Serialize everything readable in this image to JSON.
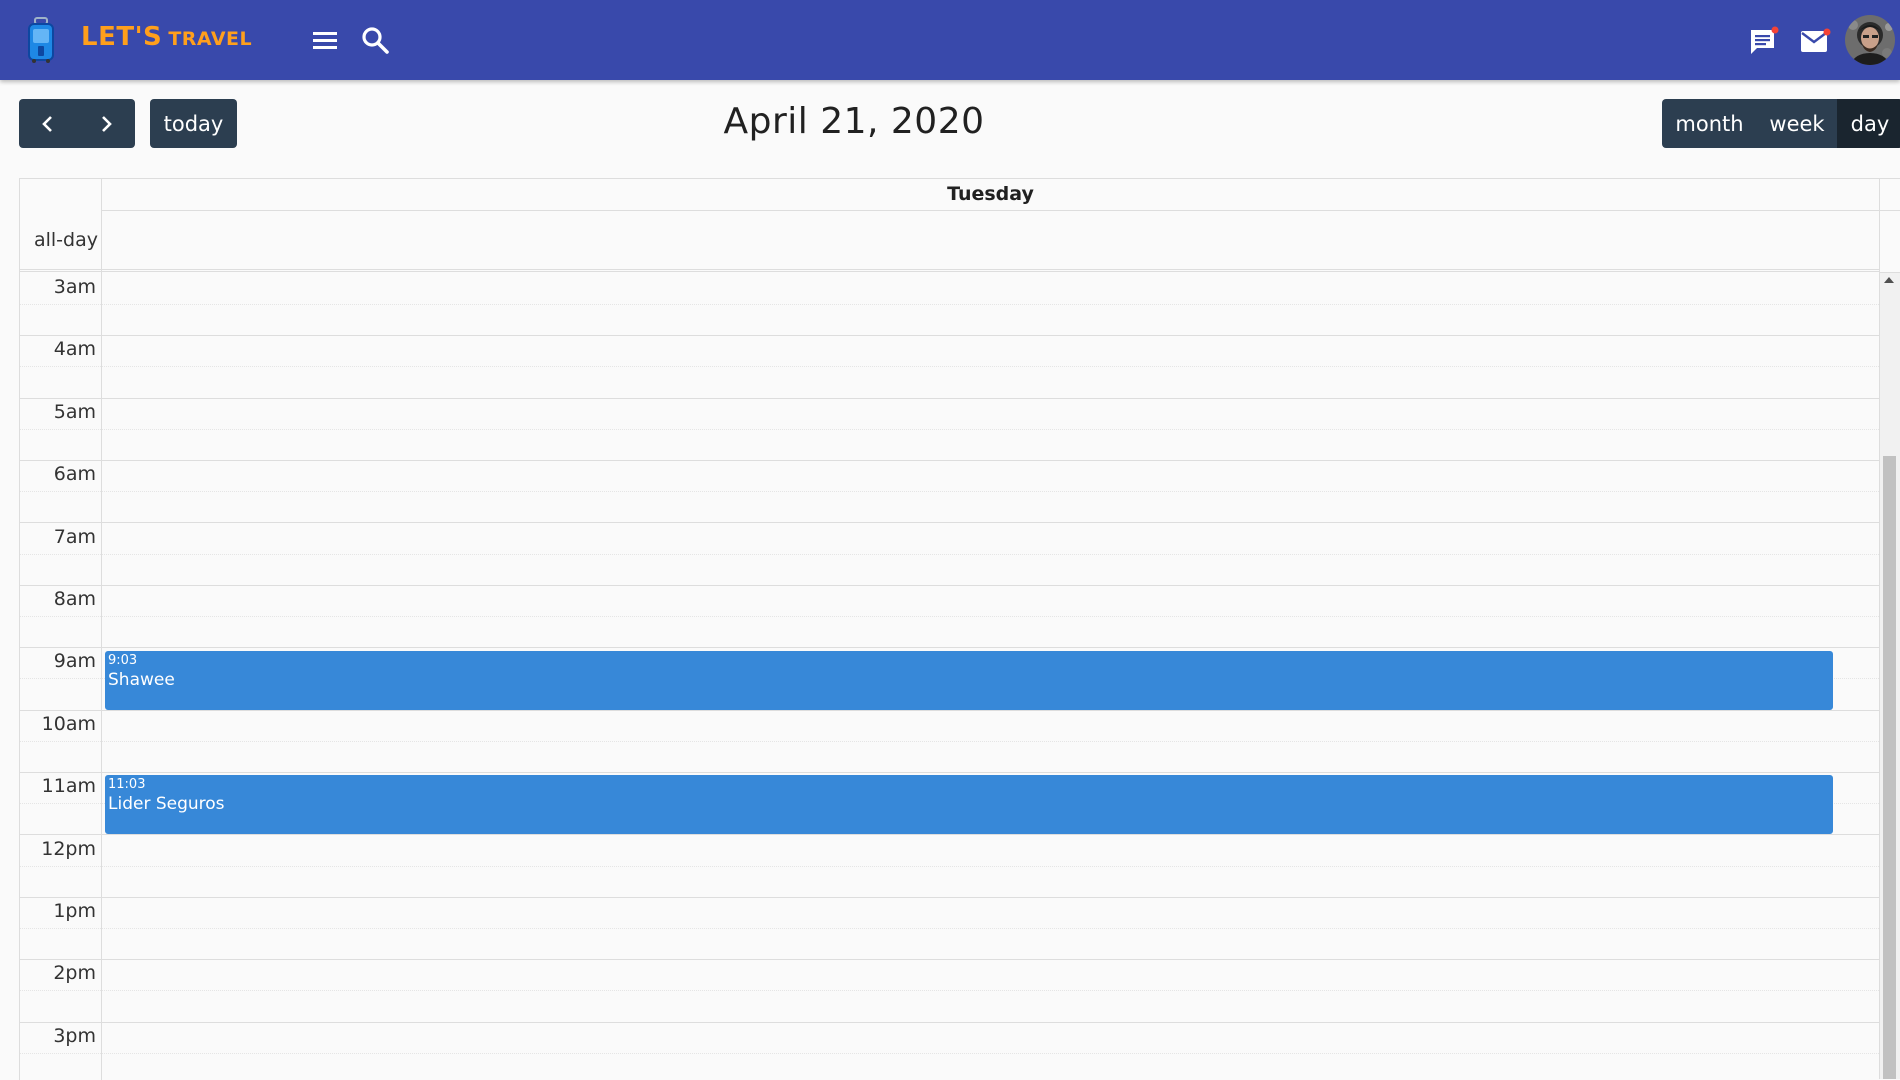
{
  "app": {
    "logo_main": "LET'S",
    "logo_sub": "TRAVEL",
    "brand_color": "#ff9f1c",
    "header_color": "#3949ab"
  },
  "header_icons": {
    "menu": "hamburger-icon",
    "search": "search-icon",
    "chat": "chat-icon",
    "mail": "mail-icon",
    "avatar": "user-avatar"
  },
  "toolbar": {
    "prev": "chevron-left-icon",
    "next": "chevron-right-icon",
    "today_label": "today",
    "title": "April 21, 2020",
    "views": [
      "month",
      "week",
      "day"
    ],
    "active_view": "day"
  },
  "calendar": {
    "day_header": "Tuesday",
    "allday_label": "all-day",
    "time_labels": [
      "3am",
      "4am",
      "5am",
      "6am",
      "7am",
      "8am",
      "9am",
      "10am",
      "11am",
      "12pm",
      "1pm",
      "2pm",
      "3pm"
    ],
    "event_color": "#3788d8",
    "events": [
      {
        "time": "9:03",
        "title": "Shawee",
        "start_hour": 9.05
      },
      {
        "time": "11:03",
        "title": "Lider Seguros",
        "start_hour": 11.05
      }
    ]
  }
}
